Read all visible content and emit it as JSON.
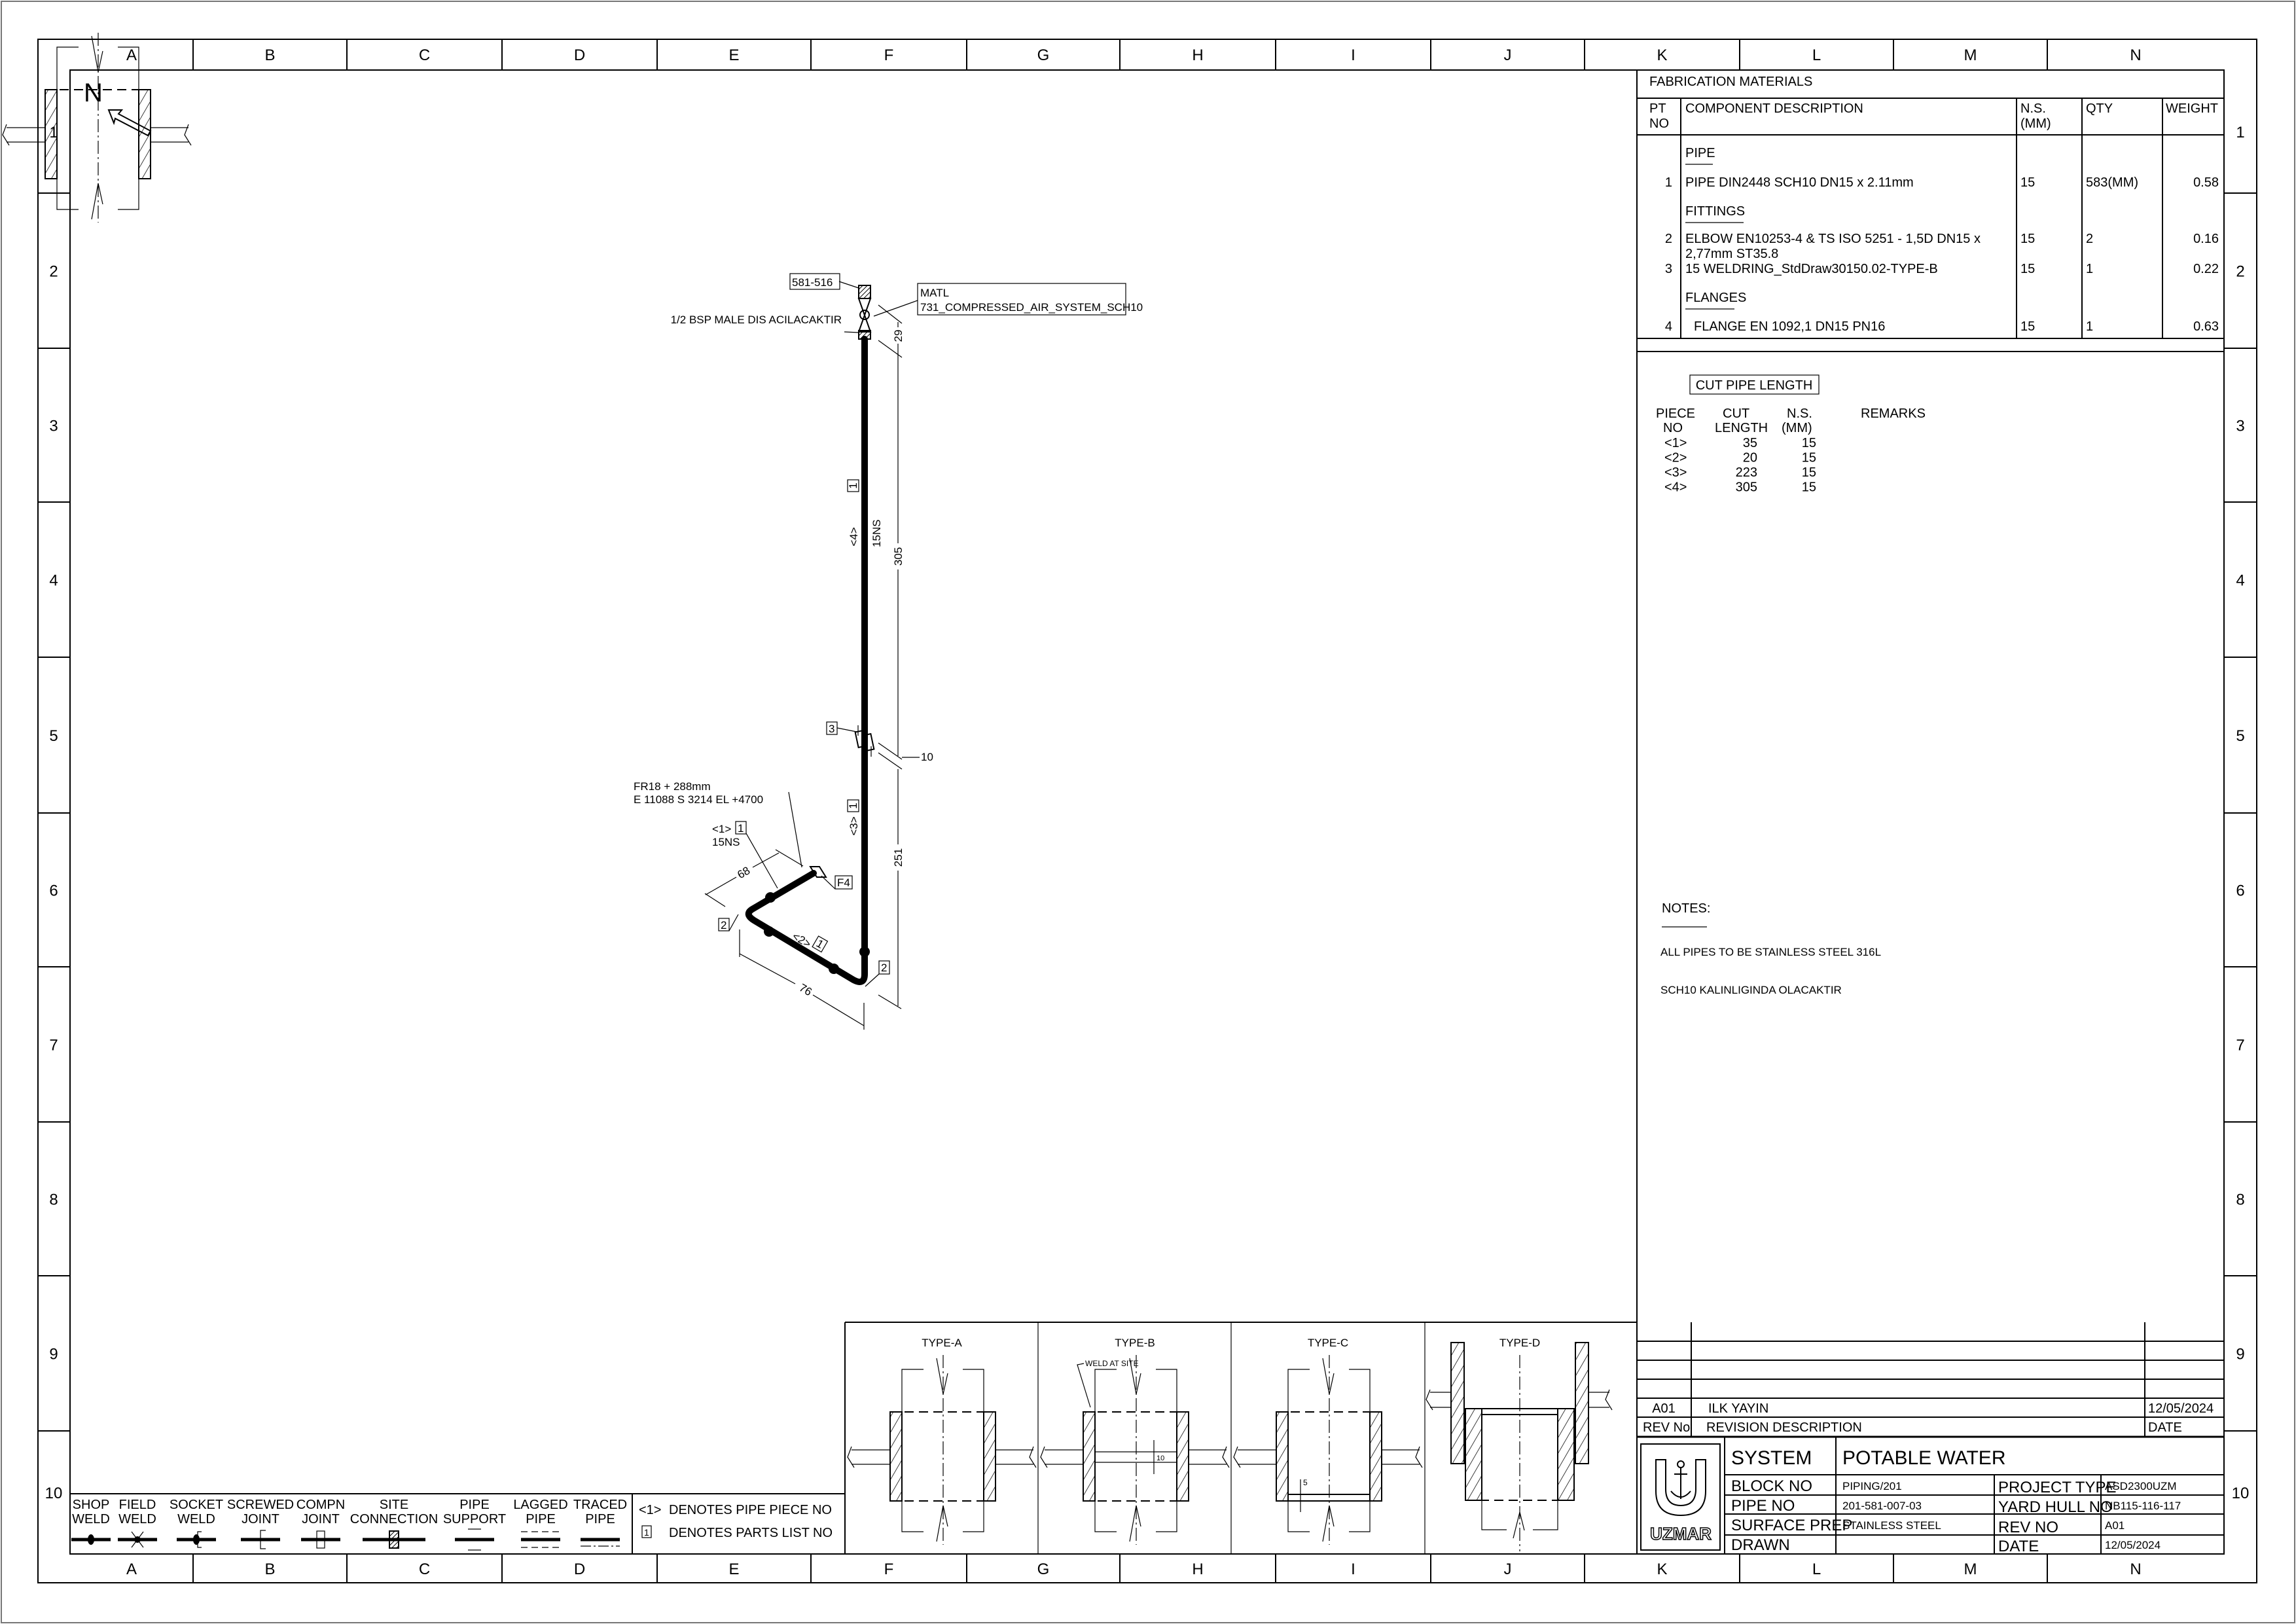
{
  "frame": {
    "columns": [
      "A",
      "B",
      "C",
      "D",
      "E",
      "F",
      "G",
      "H",
      "I",
      "J",
      "K",
      "L",
      "M",
      "N"
    ],
    "rows": [
      "1",
      "2",
      "3",
      "4",
      "5",
      "6",
      "7",
      "8",
      "9",
      "10"
    ]
  },
  "north": {
    "label": "N"
  },
  "isometric": {
    "connection_tag": "581-516",
    "matl_line1": "MATL",
    "matl_line2": "731_COMPRESSED_AIR_SYSTEM_SCH10",
    "end_note": "1/2 BSP MALE DIS ACILACAKTIR",
    "piece4": "<4>",
    "piece4_part": "1",
    "piece4_size": "15NS",
    "dim_29": "29",
    "dim_305": "305",
    "weldring_part": "3",
    "dim_10": "10",
    "location_line1": "FR18 + 288mm",
    "location_line2": "E 11088 S 3214 EL +4700",
    "piece1": "<1>",
    "piece1_part": "1",
    "piece1_size": "15NS",
    "dim_68": "68",
    "flange_tag": "F4",
    "elbow_part_left": "2",
    "piece2": "<2>",
    "piece2_part": "1",
    "elbow_part_right": "2",
    "dim_76": "76",
    "piece3": "<3>",
    "piece3_part": "1",
    "dim_251": "251"
  },
  "bom": {
    "title": "FABRICATION MATERIALS",
    "headers": {
      "pt_no_1": "PT",
      "pt_no_2": "NO",
      "description": "COMPONENT DESCRIPTION",
      "ns_1": "N.S.",
      "ns_2": "(MM)",
      "qty": "QTY",
      "weight": "WEIGHT"
    },
    "sections": {
      "pipe": "PIPE",
      "fittings": "FITTINGS",
      "flanges": "FLANGES"
    },
    "items": [
      {
        "pt": "1",
        "description": "PIPE DIN2448 SCH10 DN15 x 2.11mm",
        "description_2": "",
        "ns": "15",
        "qty": "583(MM)",
        "weight": "0.58"
      },
      {
        "pt": "2",
        "description": "ELBOW EN10253-4 & TS ISO 5251 - 1,5D DN15 x",
        "description_2": "2,77mm ST35.8",
        "ns": "15",
        "qty": "2",
        "weight": "0.16"
      },
      {
        "pt": "3",
        "description": "15 WELDRING_StdDraw30150.02-TYPE-B",
        "description_2": "",
        "ns": "15",
        "qty": "1",
        "weight": "0.22"
      },
      {
        "pt": "4",
        "description": "FLANGE EN 1092,1 DN15 PN16",
        "description_2": "",
        "ns": "15",
        "qty": "1",
        "weight": "0.63"
      }
    ]
  },
  "cut_pipe": {
    "title": "CUT PIPE LENGTH",
    "headers": {
      "piece_1": "PIECE",
      "piece_2": "NO",
      "cut_1": "CUT",
      "cut_2": "LENGTH",
      "ns_1": "N.S.",
      "ns_2": "(MM)",
      "remarks": "REMARKS"
    },
    "rows": [
      {
        "piece": "<1>",
        "length": "35",
        "ns": "15"
      },
      {
        "piece": "<2>",
        "length": "20",
        "ns": "15"
      },
      {
        "piece": "<3>",
        "length": "223",
        "ns": "15"
      },
      {
        "piece": "<4>",
        "length": "305",
        "ns": "15"
      }
    ]
  },
  "notes": {
    "title": "NOTES:",
    "lines": [
      "ALL PIPES TO BE STAINLESS STEEL 316L",
      "SCH10 KALINLIGINDA OLACAKTIR"
    ]
  },
  "details": {
    "type_a": "TYPE-A",
    "type_b": "TYPE-B",
    "type_b_note": "WELD AT SITE",
    "type_b_dim": "10",
    "type_c": "TYPE-C",
    "type_c_dim": "5",
    "type_d": "TYPE-D"
  },
  "legend": {
    "symbols": [
      {
        "line1": "SHOP",
        "line2": "WELD"
      },
      {
        "line1": "FIELD",
        "line2": "WELD"
      },
      {
        "line1": "SOCKET",
        "line2": "WELD"
      },
      {
        "line1": "SCREWED",
        "line2": "JOINT"
      },
      {
        "line1": "COMPN",
        "line2": "JOINT"
      },
      {
        "line1": "SITE",
        "line2": "CONNECTION"
      },
      {
        "line1": "PIPE",
        "line2": "SUPPORT"
      },
      {
        "line1": "LAGGED",
        "line2": "PIPE"
      },
      {
        "line1": "TRACED",
        "line2": "PIPE"
      }
    ],
    "piece_note_symbol": "<1>",
    "piece_note": "DENOTES PIPE PIECE NO",
    "parts_note_symbol": "1",
    "parts_note": "DENOTES PARTS LIST NO"
  },
  "revisions": {
    "rows": [
      {
        "rev": "A01",
        "description": "ILK YAYIN",
        "date": "12/05/2024"
      }
    ],
    "headers": {
      "rev": "REV No",
      "description": "REVISION DESCRIPTION",
      "date": "DATE"
    }
  },
  "title_block": {
    "logo_text": "UZMAR",
    "system_label": "SYSTEM",
    "system_value": "POTABLE WATER",
    "block_no_label": "BLOCK NO",
    "block_no": "PIPING/201",
    "pipe_no_label": "PIPE NO",
    "pipe_no": "201-581-007-03",
    "surface_prep_label": "SURFACE PREP",
    "surface_prep": "STAINLESS STEEL",
    "drawn_label": "DRAWN",
    "drawn": "",
    "project_type_label": "PROJECT TYPE",
    "project_type": "ASD2300UZM",
    "yard_hull_label": "YARD HULL NO",
    "yard_hull": "NB115-116-117",
    "rev_no_label": "REV NO",
    "rev_no": "A01",
    "date_label": "DATE",
    "date": "12/05/2024"
  }
}
